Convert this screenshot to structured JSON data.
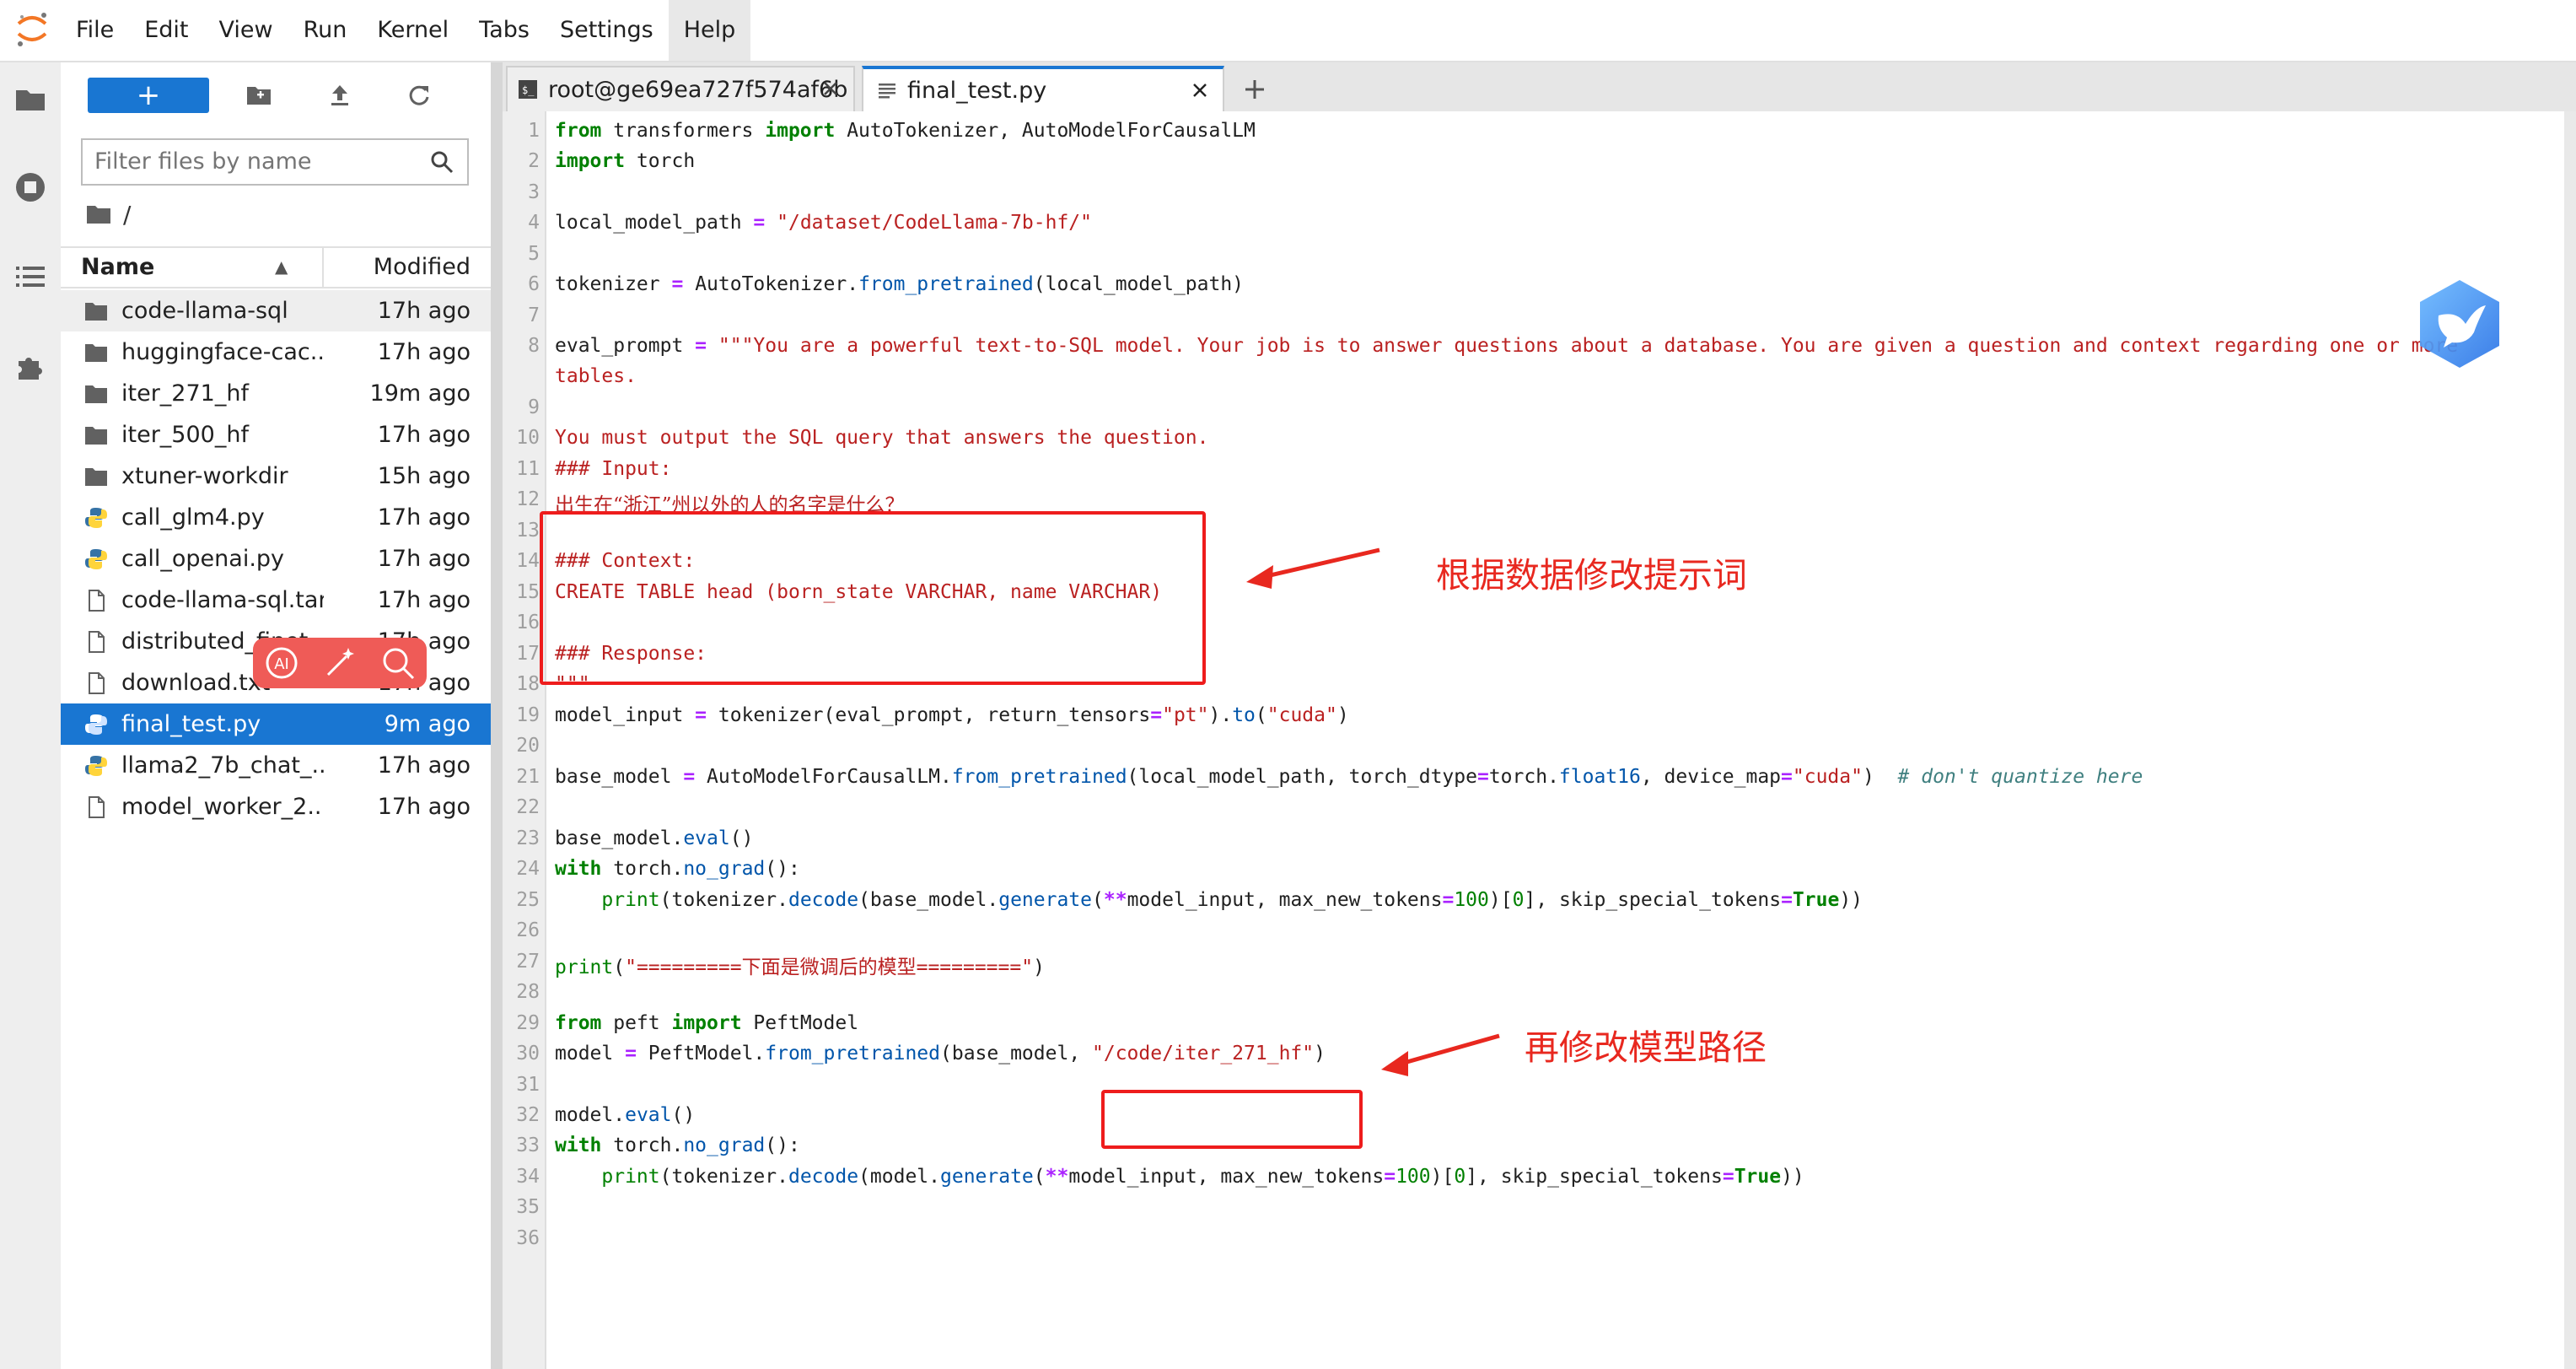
{
  "menu": {
    "items": [
      {
        "label": "File"
      },
      {
        "label": "Edit"
      },
      {
        "label": "View"
      },
      {
        "label": "Run"
      },
      {
        "label": "Kernel"
      },
      {
        "label": "Tabs"
      },
      {
        "label": "Settings"
      },
      {
        "label": "Help"
      }
    ]
  },
  "filebrowser": {
    "new_label": "+",
    "filter_placeholder": "Filter files by name",
    "breadcrumb": "/",
    "col_name": "Name",
    "col_modified": "Modified",
    "files": [
      {
        "name": "code-llama-sql",
        "modified": "17h ago",
        "type": "folder"
      },
      {
        "name": "huggingface-cac...",
        "modified": "17h ago",
        "type": "folder"
      },
      {
        "name": "iter_271_hf",
        "modified": "19m ago",
        "type": "folder"
      },
      {
        "name": "iter_500_hf",
        "modified": "17h ago",
        "type": "folder"
      },
      {
        "name": "xtuner-workdir",
        "modified": "15h ago",
        "type": "folder"
      },
      {
        "name": "call_glm4.py",
        "modified": "17h ago",
        "type": "python"
      },
      {
        "name": "call_openai.py",
        "modified": "17h ago",
        "type": "python"
      },
      {
        "name": "code-llama-sql.tar",
        "modified": "17h ago",
        "type": "file"
      },
      {
        "name": "distributed_finet...",
        "modified": "17h ago",
        "type": "file"
      },
      {
        "name": "download.txt",
        "modified": "17h ago",
        "type": "file"
      },
      {
        "name": "final_test.py",
        "modified": "9m ago",
        "type": "python"
      },
      {
        "name": "llama2_7b_chat_...",
        "modified": "17h ago",
        "type": "python"
      },
      {
        "name": "model_worker_2...",
        "modified": "17h ago",
        "type": "file"
      }
    ]
  },
  "tabs": [
    {
      "label": "root@ge69ea727f574af6b"
    },
    {
      "label": "final_test.py"
    }
  ],
  "editor": {
    "line_numbers": [
      "1",
      "2",
      "3",
      "4",
      "5",
      "6",
      "7",
      "8",
      "",
      "9",
      "10",
      "11",
      "12",
      "13",
      "14",
      "15",
      "16",
      "17",
      "18",
      "19",
      "20",
      "21",
      "22",
      "23",
      "24",
      "25",
      "26",
      "27",
      "28",
      "29",
      "30",
      "31",
      "32",
      "33",
      "34",
      "35",
      "36"
    ]
  },
  "annotations": {
    "note1": "根据数据修改提示词",
    "note2": "再修改模型路径"
  },
  "colors": {
    "accent": "#1976d2",
    "annotation": "#e8281f",
    "keyword": "#008000",
    "string": "#ba2121"
  }
}
